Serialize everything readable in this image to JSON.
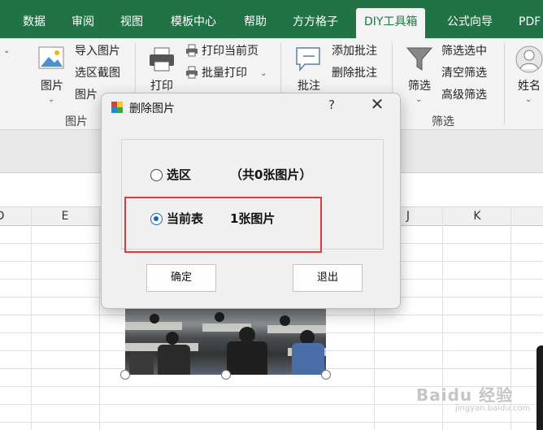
{
  "ribbon_tabs": [
    {
      "label": "数据"
    },
    {
      "label": "审阅"
    },
    {
      "label": "视图"
    },
    {
      "label": "模板中心"
    },
    {
      "label": "帮助"
    },
    {
      "label": "方方格子"
    },
    {
      "label": "DIY工具箱",
      "active": true
    },
    {
      "label": "公式向导"
    },
    {
      "label": "PDF"
    }
  ],
  "ribbon": {
    "picture_group": {
      "big_button": "图片",
      "items": [
        "导入图片",
        "选区截图",
        "图片"
      ],
      "label": "图片"
    },
    "print_group": {
      "big_button": "打印",
      "items": [
        "打印当前页",
        "批量打印"
      ]
    },
    "comment_group": {
      "big_button": "批注",
      "items": [
        "添加批注",
        "删除批注"
      ]
    },
    "filter_group": {
      "big_button": "筛选",
      "items": [
        "筛选选中",
        "清空筛选",
        "高级筛选"
      ],
      "label": "筛选"
    },
    "name_group": {
      "big_button": "姓名"
    }
  },
  "grid": {
    "column_letters": [
      "D",
      "E",
      "J",
      "K"
    ]
  },
  "dialog": {
    "title": "删除图片",
    "help": "?",
    "close": "✕",
    "options": [
      {
        "label": "选区",
        "count": "（共0张图片）",
        "checked": false
      },
      {
        "label": "当前表",
        "count": "1张图片",
        "checked": true
      }
    ],
    "ok_label": "确定",
    "exit_label": "退出"
  },
  "watermark": {
    "text": "Baidu 经验",
    "sub": "jingyan.baidu.com"
  },
  "colors": {
    "tab_bar": "#217346",
    "highlight_rect": "#e03a3a",
    "radio_checked": "#1565c0"
  }
}
